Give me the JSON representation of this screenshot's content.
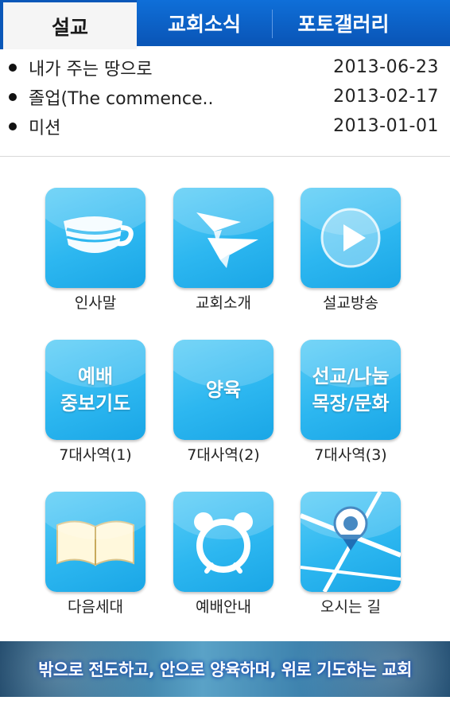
{
  "tabs": [
    {
      "label": "설교",
      "active": true
    },
    {
      "label": "교회소식",
      "active": false
    },
    {
      "label": "포토갤러리",
      "active": false
    }
  ],
  "sermons": [
    {
      "title": "내가 주는 땅으로",
      "date": "2013-06-23"
    },
    {
      "title": "졸업(The commence..",
      "date": "2013-02-17"
    },
    {
      "title": "미션",
      "date": "2013-01-01"
    }
  ],
  "menu": [
    {
      "label": "인사말",
      "icon": "cup-icon",
      "icon_text": ""
    },
    {
      "label": "교회소개",
      "icon": "paper-plane-icon",
      "icon_text": ""
    },
    {
      "label": "설교방송",
      "icon": "play-icon",
      "icon_text": ""
    },
    {
      "label": "7대사역(1)",
      "icon": "text-tile-icon",
      "icon_text": "예배\n중보기도"
    },
    {
      "label": "7대사역(2)",
      "icon": "text-tile-icon",
      "icon_text": "양육"
    },
    {
      "label": "7대사역(3)",
      "icon": "text-tile-icon",
      "icon_text": "선교/나눔\n목장/문화"
    },
    {
      "label": "다음세대",
      "icon": "book-icon",
      "icon_text": ""
    },
    {
      "label": "예배안내",
      "icon": "alarm-clock-icon",
      "icon_text": ""
    },
    {
      "label": "오시는 길",
      "icon": "map-pin-icon",
      "icon_text": ""
    }
  ],
  "banner": {
    "text": "밖으로 전도하고, 안으로 양육하며, 위로 기도하는 교회"
  },
  "colors": {
    "tab_blue": "#0a56b8",
    "tile_blue": "#2db7f0"
  }
}
